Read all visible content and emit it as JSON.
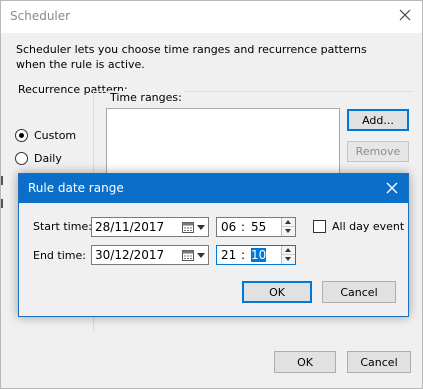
{
  "scheduler": {
    "title": "Scheduler",
    "intro": "Scheduler lets you choose time ranges and recurrence patterns when the rule is active.",
    "recurrence_label": "Recurrence pattern:",
    "radios": [
      {
        "label": "Custom",
        "checked": true
      },
      {
        "label": "Daily",
        "checked": false
      }
    ],
    "time_ranges_label": "Time ranges:",
    "add_label": "Add...",
    "remove_label": "Remove",
    "ok_label": "OK",
    "cancel_label": "Cancel"
  },
  "rule_dialog": {
    "title": "Rule date range",
    "start_label": "Start time:",
    "start_date": "28/11/2017",
    "start_hour": "06",
    "start_minute": "55",
    "end_label": "End time:",
    "end_date": "30/12/2017",
    "end_hour": "21",
    "end_minute": "10",
    "time_separator": ":",
    "all_day_label": "All day event",
    "all_day_checked": false,
    "ok_label": "OK",
    "cancel_label": "Cancel"
  },
  "colors": {
    "accent": "#0078d7",
    "dialog_title_bg": "#0b6fc9"
  }
}
